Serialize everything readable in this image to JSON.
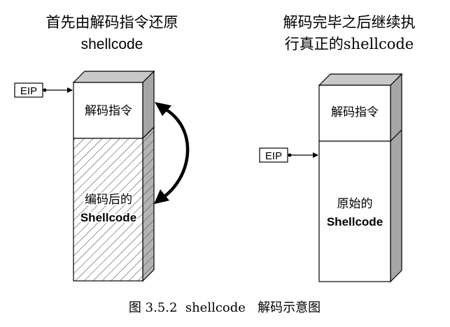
{
  "left": {
    "title_line1": "首先由解码指令还原",
    "title_line2": "shellcode",
    "eip_label": "EIP",
    "decoder_label": "解码指令",
    "encoded_label_line1": "编码后的",
    "encoded_label_line2": "Shellcode"
  },
  "right": {
    "title_line1": "解码完毕之后继续执",
    "title_line2": "行真正的shellcode",
    "eip_label": "EIP",
    "decoder_label": "解码指令",
    "original_label_line1": "原始的",
    "original_label_line2": "Shellcode"
  },
  "caption": "图 3.5.2  shellcode   解码示意图",
  "colors": {
    "box_face": "#ffffff",
    "box_side": "#a6a6a6",
    "box_top": "#c8c8c8",
    "hatch": "#555555",
    "stroke": "#000000"
  }
}
